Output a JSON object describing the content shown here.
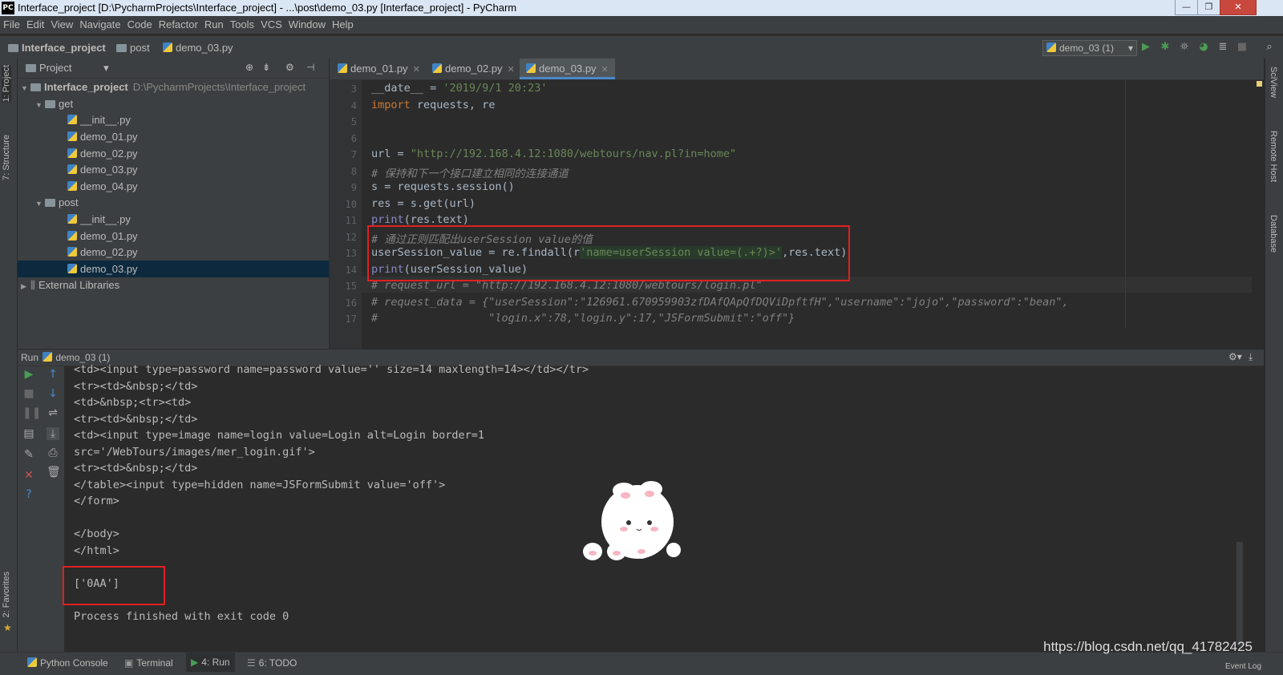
{
  "window": {
    "title": "Interface_project [D:\\PycharmProjects\\Interface_project] - ...\\post\\demo_03.py [Interface_project] - PyCharm",
    "app_badge": "PC",
    "minimize": "—",
    "maximize": "❐",
    "close": "✕"
  },
  "menu": [
    "File",
    "Edit",
    "View",
    "Navigate",
    "Code",
    "Refactor",
    "Run",
    "Tools",
    "VCS",
    "Window",
    "Help"
  ],
  "breadcrumb": {
    "project": "Interface_project",
    "folder": "post",
    "file": "demo_03.py"
  },
  "run_config": "demo_03 (1)",
  "left_stripe": {
    "project_tab": "1: Project",
    "structure_tab": "7: Structure",
    "favorites_tab": "2: Favorites"
  },
  "right_stripe": {
    "sciview": "SciView",
    "remote_host": "Remote Host",
    "database": "Database"
  },
  "project_panel": {
    "title": "Project",
    "root": "Interface_project",
    "root_path": "D:\\PycharmProjects\\Interface_project",
    "get_folder": "get",
    "get_files": [
      "__init__.py",
      "demo_01.py",
      "demo_02.py",
      "demo_03.py",
      "demo_04.py"
    ],
    "post_folder": "post",
    "post_files": [
      "__init__.py",
      "demo_01.py",
      "demo_02.py",
      "demo_03.py"
    ],
    "external": "External Libraries"
  },
  "editor_tabs": [
    "demo_01.py",
    "demo_02.py",
    "demo_03.py"
  ],
  "code": {
    "line_numbers": [
      "3",
      "4",
      "5",
      "6",
      "7",
      "8",
      "9",
      "10",
      "11",
      "12",
      "13",
      "14",
      "15",
      "16",
      "17"
    ],
    "l3_a": "__date__ = ",
    "l3_b": "'2019/9/1 20:23'",
    "l4_a": "import",
    "l4_b": " requests, re",
    "l7_a": "url = ",
    "l7_b": "\"http://192.168.4.12:1080/webtours/nav.pl?in=home\"",
    "l8": "# 保持和下一个接口建立相同的连接通道",
    "l9": "s = requests.session()",
    "l10": "res = s.get(url)",
    "l11_a": "print",
    "l11_b": "(res.text)",
    "l12": "# 通过正则匹配出userSession value的值",
    "l13_a": "userSession_value = re.findall(r",
    "l13_b": "'name=userSession value=(.+?)>'",
    "l13_c": ",res.text)",
    "l14_a": "print",
    "l14_b": "(userSession_value)",
    "l15": "# request_url = \"http://192.168.4.12:1080/webtours/login.pl\"",
    "l16": "# request_data = {\"userSession\":\"126961.670959903zfDAfQApQfDQViDpftfH\",\"username\":\"jojo\",\"password\":\"bean\",",
    "l17": "#                 \"login.x\":78,\"login.y\":17,\"JSFormSubmit\":\"off\"}"
  },
  "run_panel": {
    "label": "Run",
    "config": "demo_03 (1)",
    "output": [
      "<td><input type=password name=password value='' size=14 maxlength=14></td></tr>",
      "<tr><td>&nbsp;</td>",
      "<td>&nbsp;<tr><td>",
      "<tr><td>&nbsp;</td>",
      "<td><input type=image name=login value=Login alt=Login border=1",
      "src='/WebTours/images/mer_login.gif'>",
      "<tr><td>&nbsp;</td>",
      "</table><input type=hidden name=JSFormSubmit value='off'>",
      "</form>",
      "",
      "</body>",
      "</html>",
      "",
      "['0AA']",
      "",
      "Process finished with exit code 0"
    ]
  },
  "statusbar": {
    "python_console": "Python Console",
    "terminal": "Terminal",
    "run": "4: Run",
    "todo": "6: TODO",
    "event_log": "Event Log"
  },
  "watermark": "https://blog.csdn.net/qq_41782425",
  "colors": {
    "accent": "#4a88c7",
    "highlight_box": "#e02020",
    "run_green": "#499c54"
  }
}
